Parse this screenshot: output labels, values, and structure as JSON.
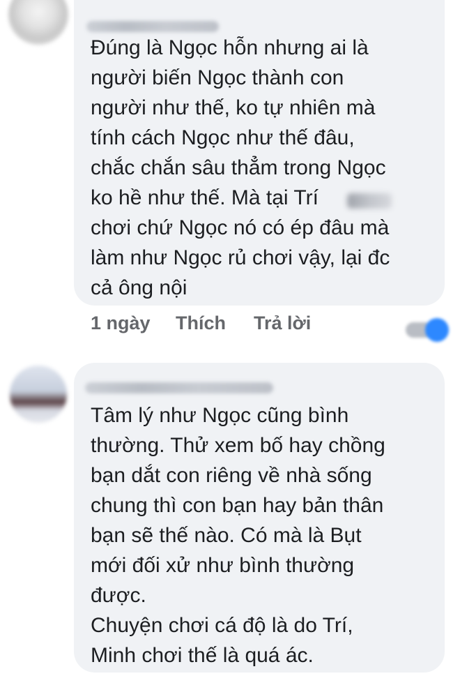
{
  "comments": [
    {
      "text": "Đúng là Ngọc hỗn nhưng ai là\nngười biến Ngọc thành con\nngười như thế, ko tự nhiên mà\ntính cách Ngọc như thế đâu,\nchắc chắn sâu thẳm trong Ngọc\nko hề như thế. Mà tại Trí\nchơi chứ Ngọc nó có ép đâu mà\nlàm như Ngọc rủ chơi vậy, lại đc\ncả ông nội",
      "time": "1 ngày",
      "like_label": "Thích",
      "reply_label": "Trả lời"
    },
    {
      "text": "Tâm lý như Ngọc cũng bình\nthường. Thử xem bố hay chồng\nbạn dắt con riêng về nhà sống\nchung thì con bạn hay bản thân\nbạn sẽ thế nào. Có mà là Bụt\nmới đối xử như bình thường\nđược.\nChuyện chơi cá độ là do Trí,\nMinh chơi thế là quá ác."
    }
  ],
  "colors": {
    "bubble": "#f0f2f5",
    "text": "#1c1e21",
    "secondary_text": "#65676b",
    "reaction_blue": "#2d88ff"
  },
  "icons": {
    "reaction": "reaction-icon"
  }
}
